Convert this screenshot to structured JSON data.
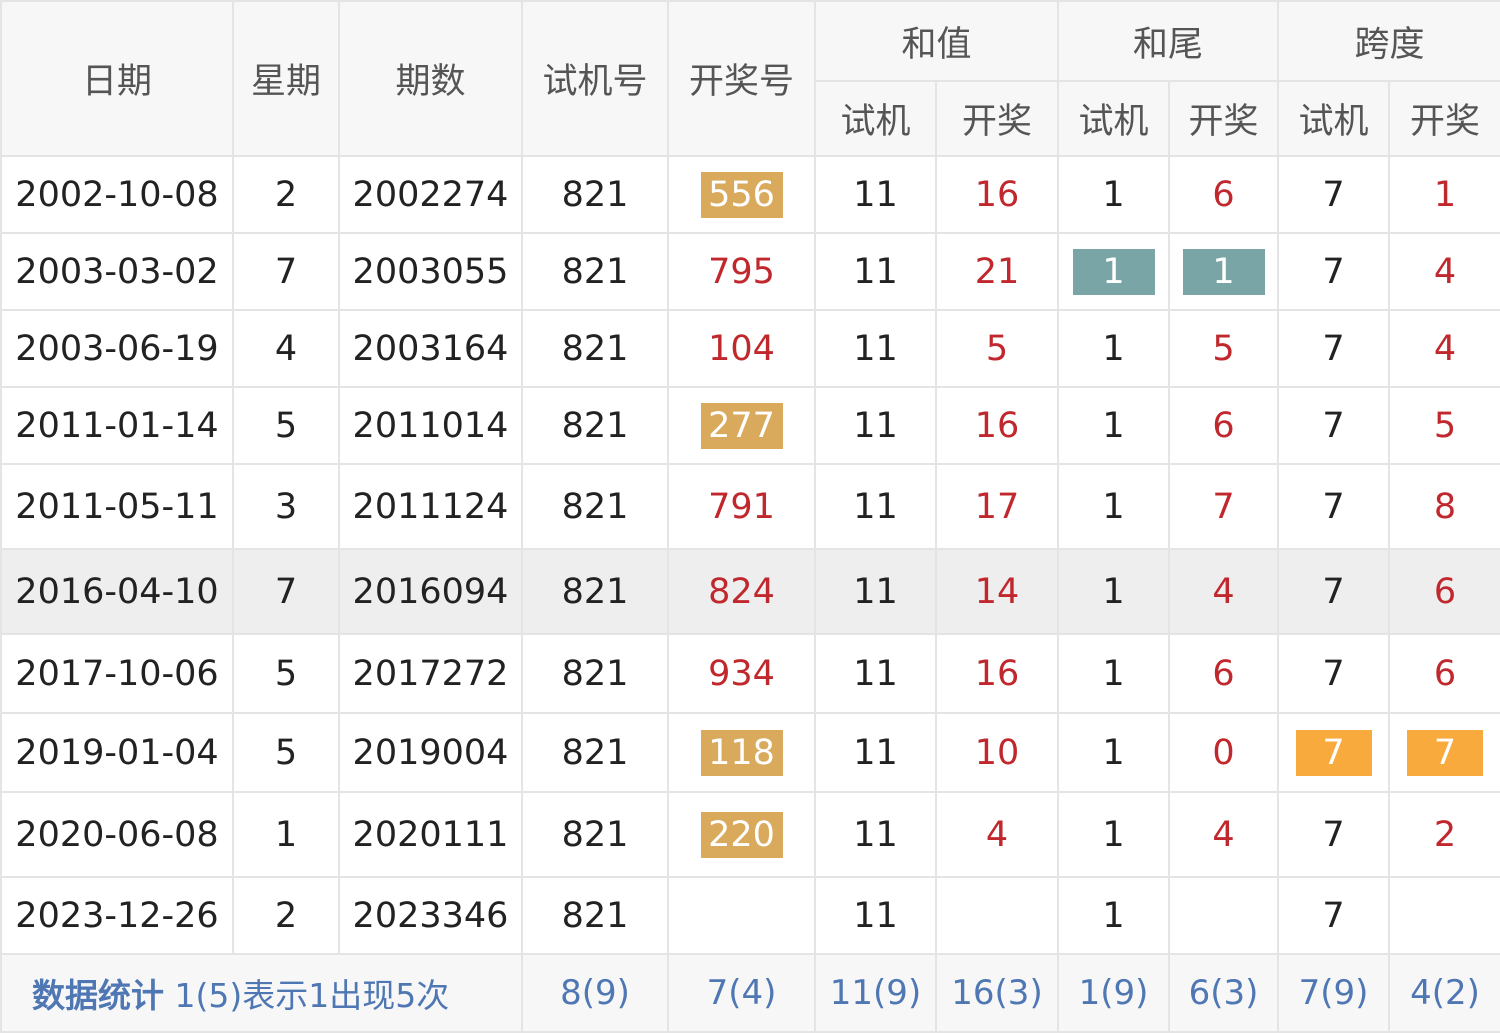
{
  "header": {
    "date": "日期",
    "weekday": "星期",
    "issue": "期数",
    "trial_number": "试机号",
    "draw_number": "开奖号",
    "sum_group": "和值",
    "tail_group": "和尾",
    "span_group": "跨度",
    "sub_trial": "试机",
    "sub_draw": "开奖"
  },
  "rows": [
    {
      "date": "2002-10-08",
      "weekday": "2",
      "issue": "2002274",
      "trial": "821",
      "draw": "556",
      "sum_trial": "11",
      "sum_draw": "16",
      "tail_trial": "1",
      "tail_draw": "6",
      "span_trial": "7",
      "span_draw": "1"
    },
    {
      "date": "2003-03-02",
      "weekday": "7",
      "issue": "2003055",
      "trial": "821",
      "draw": "795",
      "sum_trial": "11",
      "sum_draw": "21",
      "tail_trial": "1",
      "tail_draw": "1",
      "span_trial": "7",
      "span_draw": "4"
    },
    {
      "date": "2003-06-19",
      "weekday": "4",
      "issue": "2003164",
      "trial": "821",
      "draw": "104",
      "sum_trial": "11",
      "sum_draw": "5",
      "tail_trial": "1",
      "tail_draw": "5",
      "span_trial": "7",
      "span_draw": "4"
    },
    {
      "date": "2011-01-14",
      "weekday": "5",
      "issue": "2011014",
      "trial": "821",
      "draw": "277",
      "sum_trial": "11",
      "sum_draw": "16",
      "tail_trial": "1",
      "tail_draw": "6",
      "span_trial": "7",
      "span_draw": "5"
    },
    {
      "date": "2011-05-11",
      "weekday": "3",
      "issue": "2011124",
      "trial": "821",
      "draw": "791",
      "sum_trial": "11",
      "sum_draw": "17",
      "tail_trial": "1",
      "tail_draw": "7",
      "span_trial": "7",
      "span_draw": "8"
    },
    {
      "date": "2016-04-10",
      "weekday": "7",
      "issue": "2016094",
      "trial": "821",
      "draw": "824",
      "sum_trial": "11",
      "sum_draw": "14",
      "tail_trial": "1",
      "tail_draw": "4",
      "span_trial": "7",
      "span_draw": "6"
    },
    {
      "date": "2017-10-06",
      "weekday": "5",
      "issue": "2017272",
      "trial": "821",
      "draw": "934",
      "sum_trial": "11",
      "sum_draw": "16",
      "tail_trial": "1",
      "tail_draw": "6",
      "span_trial": "7",
      "span_draw": "6"
    },
    {
      "date": "2019-01-04",
      "weekday": "5",
      "issue": "2019004",
      "trial": "821",
      "draw": "118",
      "sum_trial": "11",
      "sum_draw": "10",
      "tail_trial": "1",
      "tail_draw": "0",
      "span_trial": "7",
      "span_draw": "7"
    },
    {
      "date": "2020-06-08",
      "weekday": "1",
      "issue": "2020111",
      "trial": "821",
      "draw": "220",
      "sum_trial": "11",
      "sum_draw": "4",
      "tail_trial": "1",
      "tail_draw": "4",
      "span_trial": "7",
      "span_draw": "2"
    },
    {
      "date": "2023-12-26",
      "weekday": "2",
      "issue": "2023346",
      "trial": "821",
      "draw": "",
      "sum_trial": "11",
      "sum_draw": "",
      "tail_trial": "1",
      "tail_draw": "",
      "span_trial": "7",
      "span_draw": ""
    }
  ],
  "footer": {
    "title": "数据统计",
    "note": "1(5)表示1出现5次",
    "trial": "8(9)",
    "draw": "7(4)",
    "sum_trial": "11(9)",
    "sum_draw": "16(3)",
    "tail_trial": "1(9)",
    "tail_draw": "6(3)",
    "span_trial": "7(9)",
    "span_draw": "4(2)"
  },
  "colors": {
    "highlight_gold": "#d9a95c",
    "highlight_teal": "#7aa5a7",
    "highlight_orange": "#f8ab3c",
    "draw_red": "#c0282d",
    "footer_blue": "#4e77b3"
  }
}
